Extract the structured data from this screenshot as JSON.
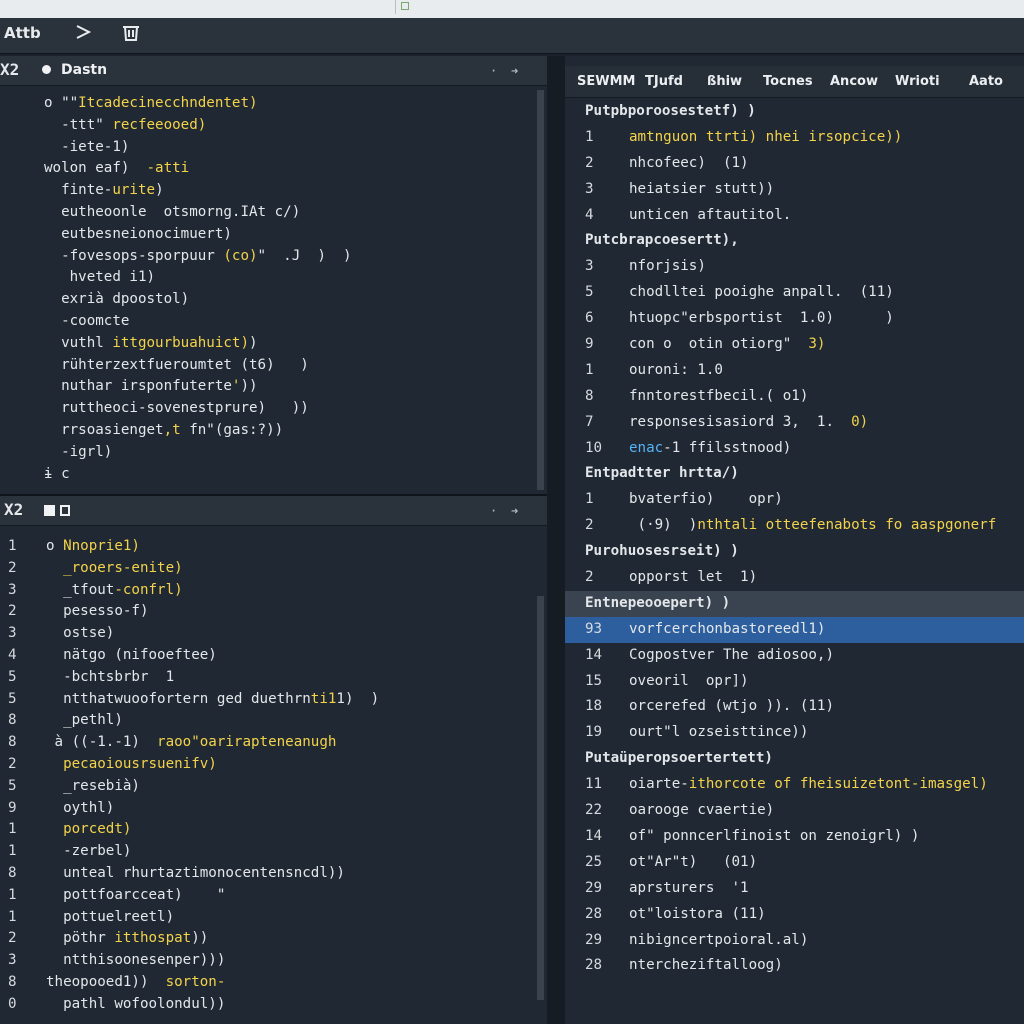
{
  "toolbar": {
    "title": "Attb",
    "run_icon": "play-icon",
    "trash_icon": "trash-icon"
  },
  "left_top": {
    "close_label": "X2",
    "title": "Dastn",
    "lines": [
      {
        "t": "o \"\"",
        "y": "Itcadecinecchndentet)"
      },
      {
        "w": "  -ttt\" ",
        "y": "recfeeooed)"
      },
      {
        "w": "  -iete-1)"
      },
      {
        "y": "  -atti ",
        "w": "wolon eaf)"
      },
      {
        "w": "  finte-",
        "y": "urite",
        "w2": ")"
      },
      {
        "w": "  eutheoonle  otsmorng.IAt c/)"
      },
      {
        "w": "  eutbesneionocimuert)"
      },
      {
        "w": "  -fovesops-sporpuur ",
        "y": "(co)",
        "w2": "\"  .J  )  )"
      },
      {
        "w": "   hveted i1)"
      },
      {
        "w": "  exrià dpoostol)"
      },
      {
        "w": "  -coomcte"
      },
      {
        "w": "  vuthl ",
        "y": "ittgourbuahuict)",
        "w2": ")"
      },
      {
        "w": "  rühterzextfueroumtet (t6)   )"
      },
      {
        "w": "  nuthar irsponfuterte",
        "y": "'",
        "w2": "))"
      },
      {
        "w": "  ruttheoci-sovenestprure)   ))"
      },
      {
        "w": "  rrsoasienget",
        "y": ",t",
        "w2": " fn\"(gas:?))"
      },
      {
        "w": "  -igrl)"
      },
      {
        "w": "ɨ c"
      }
    ]
  },
  "left_bottom": {
    "close_label": "X2",
    "line_numbers": [
      "1",
      "2",
      "3",
      "2",
      "3",
      "4",
      "5",
      "5",
      "8",
      "8",
      "2",
      "5",
      "9",
      "1",
      "1",
      "8",
      "1",
      "1",
      "2",
      "3",
      "8",
      "0"
    ],
    "lines": [
      {
        "w": "o ",
        "y": "Nnoprie1)"
      },
      {
        "y": "  _rooers-enite)"
      },
      {
        "w": "  _tfout",
        "y": "-confrl)"
      },
      {
        "w": "  pesesso-f)"
      },
      {
        "w": "  ostse)"
      },
      {
        "w": "  nätgo (nifooeftee)"
      },
      {
        "w": "  -bchtsbrbr  1"
      },
      {
        "w": "  ntthatwuoofortern ged duethrn",
        "y": "ti1",
        "w2": "1)  )"
      },
      {
        "w": "  _pethl)"
      },
      {
        "y": "  raoo\"oarirapteneanugh",
        "w": " à ((-1.-1)"
      },
      {
        "y": "  pecaoiousrsuenifv)"
      },
      {
        "w": "  _resebià)"
      },
      {
        "w": "  oythl)"
      },
      {
        "y": "  porcedt)"
      },
      {
        "w": "  -zerbel)"
      },
      {
        "w": "  unteal rhurtaztimonocentensncdl))"
      },
      {
        "w": "  pottfoarcceat)    \""
      },
      {
        "w": "  pottuelreetl)"
      },
      {
        "w": "  pöthr ",
        "y": "itthospat",
        "w2": "))"
      },
      {
        "w": "  ntthisoonesenper)))"
      },
      {
        "y": "  sorton-",
        "w": "theopooed1))"
      },
      {
        "w": "  pathl wofoolondul))"
      }
    ]
  },
  "right": {
    "tabs": [
      "SEWMM",
      "TJufd",
      "ßhiw",
      "Tocnes",
      "Ancow",
      "Wrioti",
      "Aato"
    ],
    "rows": [
      {
        "kind": "head",
        "text": "Putpbporoosestetf) )"
      },
      {
        "n": "1",
        "y": "amtnguon ttrti) nhei irsopcice))"
      },
      {
        "n": "2",
        "w": "nhcofeec)  (1)"
      },
      {
        "n": "3",
        "w": "heiatsier stutt))"
      },
      {
        "n": "4",
        "w": "unticen aftautitol."
      },
      {
        "kind": "head",
        "text": "Putcbrapcoesertt),"
      },
      {
        "n": "3",
        "w": "nforjsis)"
      },
      {
        "n": "5",
        "w": "chodlltei pooighe anpall.  (11)"
      },
      {
        "n": "6",
        "w": "htuopc\"erbsportist  1.0)      )"
      },
      {
        "n": "9",
        "w": "con o  otin otiorg\"  ",
        "y": "3)"
      },
      {
        "n": "1",
        "w": "ouroni: 1.0"
      },
      {
        "n": "8",
        "w": "fnntorestfbecil.( o1)"
      },
      {
        "n": "7",
        "w": "responsesisasiord 3,  1.  ",
        "y": "0)"
      },
      {
        "n": "10",
        "b": "enac",
        "w": "-1 ffilsstnood)"
      },
      {
        "kind": "head",
        "text": "Entpadtter hrtta/)"
      },
      {
        "n": "1",
        "w": "bvaterfio)    opr)"
      },
      {
        "n": "2",
        "y": "nthtali otteefenabots fo aaspgonerf",
        "w": " (·9)  )"
      },
      {
        "kind": "head",
        "text": "Purohuosesrseit) )"
      },
      {
        "n": "2",
        "w": "opporst let  1)"
      },
      {
        "kind": "headhl",
        "text": "Entnepeooepert) )"
      },
      {
        "kind": "sel",
        "n": "93",
        "w": "vorfcerchonbastoreedl1)"
      },
      {
        "n": "14",
        "w": "Cogpostver The adiosoo,)"
      },
      {
        "n": "15",
        "w": "oveoril  opr])"
      },
      {
        "n": "18",
        "w": "orcerefed (wtjo )). (11)"
      },
      {
        "n": "19",
        "w": "ourt\"l ozseisttince))"
      },
      {
        "kind": "head",
        "text": "Putaüperopsoertertett)"
      },
      {
        "n": "11",
        "y": "ithorcote of fheisuizetont-",
        "w": "oiarte-",
        "y2": "imasgel)"
      },
      {
        "n": "22",
        "w": "oarooge cvaertie)"
      },
      {
        "n": "14",
        "w": "of\" ponncerlfinoist on zenoigrl) )"
      },
      {
        "n": "25",
        "w": "ot\"Ar\"t)   (01)"
      },
      {
        "n": "29",
        "w": "aprsturers  '1"
      },
      {
        "n": "28",
        "w": "ot\"loistora (11)"
      },
      {
        "n": "29",
        "w": "nibigncertpoioral.al)"
      },
      {
        "n": "28",
        "w": "ntercheziftalloog)"
      }
    ]
  },
  "colors": {
    "bg": "#1f2833",
    "accent_yellow": "#f3d34a",
    "selection": "#2d5f9e"
  }
}
